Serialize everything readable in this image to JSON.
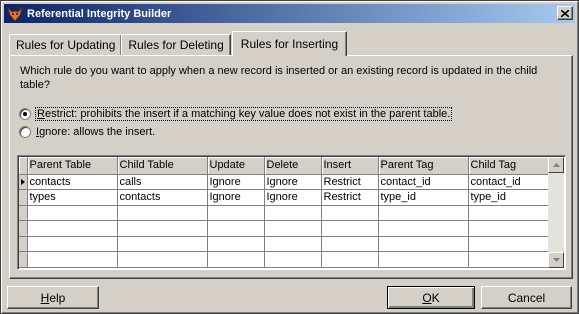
{
  "window": {
    "title": "Referential Integrity Builder",
    "icon": "fox-icon"
  },
  "tabs": [
    {
      "label": "Rules for Updating",
      "active": false
    },
    {
      "label": "Rules for Deleting",
      "active": false
    },
    {
      "label": "Rules for Inserting",
      "active": true
    }
  ],
  "panel": {
    "question": "Which rule do you want to apply when a new record is inserted or an existing record is updated in the child table?",
    "options": [
      {
        "hotkey": "R",
        "rest": "estrict: prohibits the insert if a matching key value does not exist in the parent table.",
        "selected": true
      },
      {
        "hotkey": "I",
        "rest": "gnore: allows the insert.",
        "selected": false
      }
    ]
  },
  "grid": {
    "columns": [
      "Parent Table",
      "Child Table",
      "Update",
      "Delete",
      "Insert",
      "Parent Tag",
      "Child Tag"
    ],
    "rows": [
      [
        "contacts",
        "calls",
        "Ignore",
        "Ignore",
        "Restrict",
        "contact_id",
        "contact_id"
      ],
      [
        "types",
        "contacts",
        "Ignore",
        "Ignore",
        "Restrict",
        "type_id",
        "type_id"
      ],
      [
        "",
        "",
        "",
        "",
        "",
        "",
        ""
      ],
      [
        "",
        "",
        "",
        "",
        "",
        "",
        ""
      ],
      [
        "",
        "",
        "",
        "",
        "",
        "",
        ""
      ],
      [
        "",
        "",
        "",
        "",
        "",
        "",
        ""
      ]
    ],
    "current_row": 0
  },
  "buttons": {
    "help_hotkey": "H",
    "help_rest": "elp",
    "ok_hotkey": "O",
    "ok_rest": "K",
    "cancel": "Cancel"
  }
}
